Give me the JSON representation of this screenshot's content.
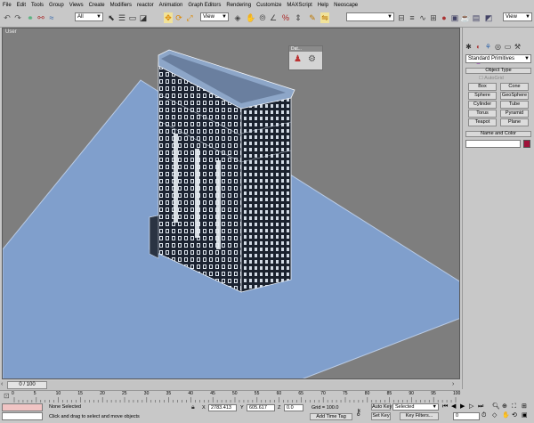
{
  "menu": [
    "File",
    "Edit",
    "Tools",
    "Group",
    "Views",
    "Create",
    "Modifiers",
    "reactor",
    "Animation",
    "Graph Editors",
    "Rendering",
    "Customize",
    "MAXScript",
    "Help",
    "Neoscape"
  ],
  "toolbar": {
    "filter_value": "All",
    "view_value": "View",
    "right_view_value": "View",
    "named_selection_value": ""
  },
  "viewport": {
    "label": "User",
    "bg": "#7e7e7e",
    "plane_color": "#7f9fcc",
    "building_color": "#1c2430"
  },
  "floater": {
    "title": "Dat..."
  },
  "command_panel": {
    "category": "Standard Primitives",
    "object_type_title": "Object Type",
    "autogrid": "AutoGrid",
    "buttons": [
      "Box",
      "Cone",
      "Sphere",
      "GeoSphere",
      "Cylinder",
      "Tube",
      "Torus",
      "Pyramid",
      "Teapot",
      "Plane"
    ],
    "name_color_title": "Name and Color",
    "object_name": "",
    "color_swatch": "#a0123a"
  },
  "time": {
    "slider_label": "0 / 100",
    "ticks": [
      "0",
      "5",
      "10",
      "15",
      "20",
      "25",
      "30",
      "35",
      "40",
      "45",
      "50",
      "55",
      "60",
      "65",
      "70",
      "75",
      "80",
      "85",
      "90",
      "95",
      "100"
    ]
  },
  "status": {
    "selection": "None Selected",
    "prompt": "Click and drag to select and move objects",
    "x_label": "X",
    "x_value": "2783.413",
    "y_label": "Y",
    "y_value": "605.617",
    "z_label": "Z",
    "z_value": "0.0",
    "grid": "Grid = 100.0",
    "add_time_tag": "Add Time Tag",
    "auto_key": "Auto Key",
    "set_key": "Set Key",
    "key_mode": "Selected",
    "key_filters": "Key Filters...",
    "frame": "0"
  }
}
